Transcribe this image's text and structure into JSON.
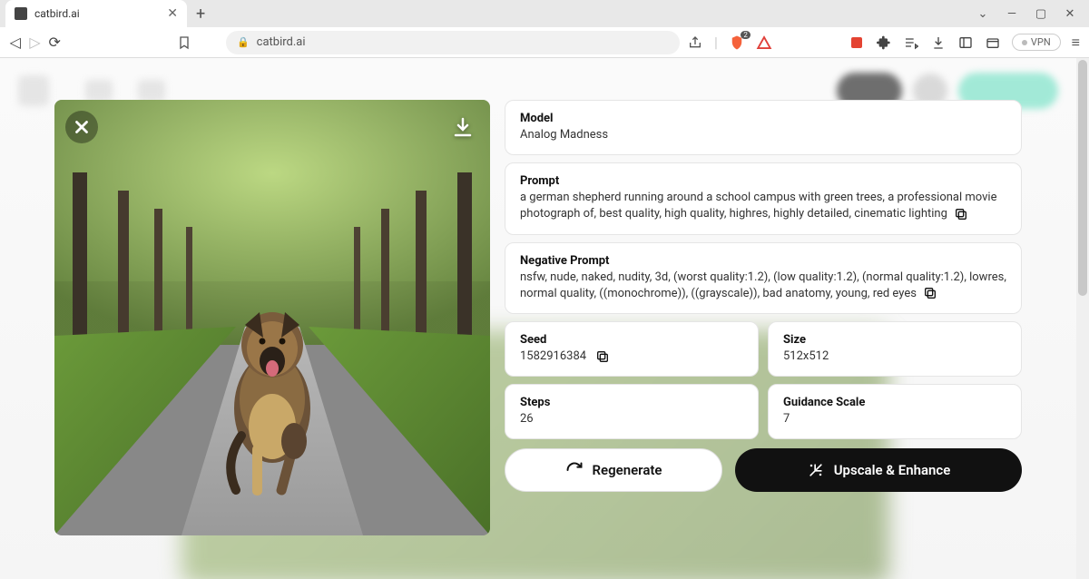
{
  "browser": {
    "tab_title": "catbird.ai",
    "url": "catbird.ai",
    "vpn_label": "VPN",
    "brave_count": "2"
  },
  "details": {
    "model": {
      "label": "Model",
      "value": "Analog Madness"
    },
    "prompt": {
      "label": "Prompt",
      "value": "a german shepherd running around a school campus with green trees, a professional movie photograph of, best quality, high quality, highres, highly detailed, cinematic lighting"
    },
    "negative": {
      "label": "Negative Prompt",
      "value": "nsfw, nude, naked, nudity, 3d, (worst quality:1.2), (low quality:1.2), (normal quality:1.2), lowres, normal quality, ((monochrome)), ((grayscale)), bad anatomy, young, red eyes"
    },
    "seed": {
      "label": "Seed",
      "value": "1582916384"
    },
    "size": {
      "label": "Size",
      "value": "512x512"
    },
    "steps": {
      "label": "Steps",
      "value": "26"
    },
    "guidance": {
      "label": "Guidance Scale",
      "value": "7"
    }
  },
  "actions": {
    "regenerate": "Regenerate",
    "upscale": "Upscale & Enhance"
  }
}
